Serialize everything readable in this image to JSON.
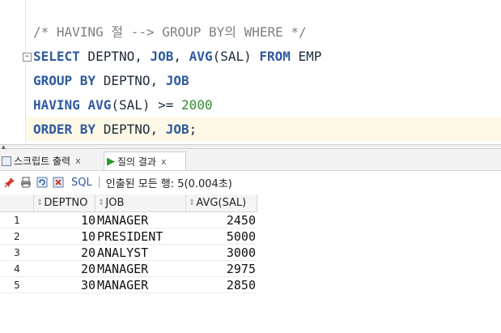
{
  "editor": {
    "lines": [
      {
        "parts": [
          {
            "t": "/* HAVING 절 --> GROUP BY의 WHERE */",
            "c": "cm"
          }
        ]
      },
      {
        "parts": [
          {
            "t": "SELECT",
            "c": "kw"
          },
          {
            "t": " DEPTNO, ",
            "c": ""
          },
          {
            "t": "JOB",
            "c": "kw"
          },
          {
            "t": ", ",
            "c": ""
          },
          {
            "t": "AVG",
            "c": "kw"
          },
          {
            "t": "(SAL) ",
            "c": ""
          },
          {
            "t": "FROM",
            "c": "kw"
          },
          {
            "t": " EMP",
            "c": ""
          }
        ]
      },
      {
        "parts": [
          {
            "t": "GROUP BY",
            "c": "kw"
          },
          {
            "t": " DEPTNO, ",
            "c": ""
          },
          {
            "t": "JOB",
            "c": "kw"
          }
        ]
      },
      {
        "parts": [
          {
            "t": "HAVING",
            "c": "kw"
          },
          {
            "t": " ",
            "c": ""
          },
          {
            "t": "AVG",
            "c": "kw"
          },
          {
            "t": "(SAL) >= ",
            "c": ""
          },
          {
            "t": "2000",
            "c": "num"
          }
        ]
      },
      {
        "parts": [
          {
            "t": "ORDER BY",
            "c": "kw"
          },
          {
            "t": " DEPTNO, ",
            "c": ""
          },
          {
            "t": "JOB",
            "c": "kw"
          },
          {
            "t": ";",
            "c": ""
          }
        ]
      }
    ],
    "fold_symbol": "−"
  },
  "tabs": {
    "script_output": "스크립트 출력",
    "query_result": "질의 결과",
    "close": "x"
  },
  "toolbar": {
    "sql_label": "SQL",
    "status": "인출된 모든 행: 5(0.004초)"
  },
  "result": {
    "columns": [
      "DEPTNO",
      "JOB",
      "AVG(SAL)"
    ],
    "rows": [
      {
        "n": "1",
        "deptno": "10",
        "job": "MANAGER",
        "avg": "2450"
      },
      {
        "n": "2",
        "deptno": "10",
        "job": "PRESIDENT",
        "avg": "5000"
      },
      {
        "n": "3",
        "deptno": "20",
        "job": "ANALYST",
        "avg": "3000"
      },
      {
        "n": "4",
        "deptno": "20",
        "job": "MANAGER",
        "avg": "2975"
      },
      {
        "n": "5",
        "deptno": "30",
        "job": "MANAGER",
        "avg": "2850"
      }
    ]
  },
  "colors": {
    "keyword": "#2f5a9e",
    "comment": "#7f7f7f",
    "number": "#2e8b2e",
    "current_line": "#fdf9e6"
  }
}
